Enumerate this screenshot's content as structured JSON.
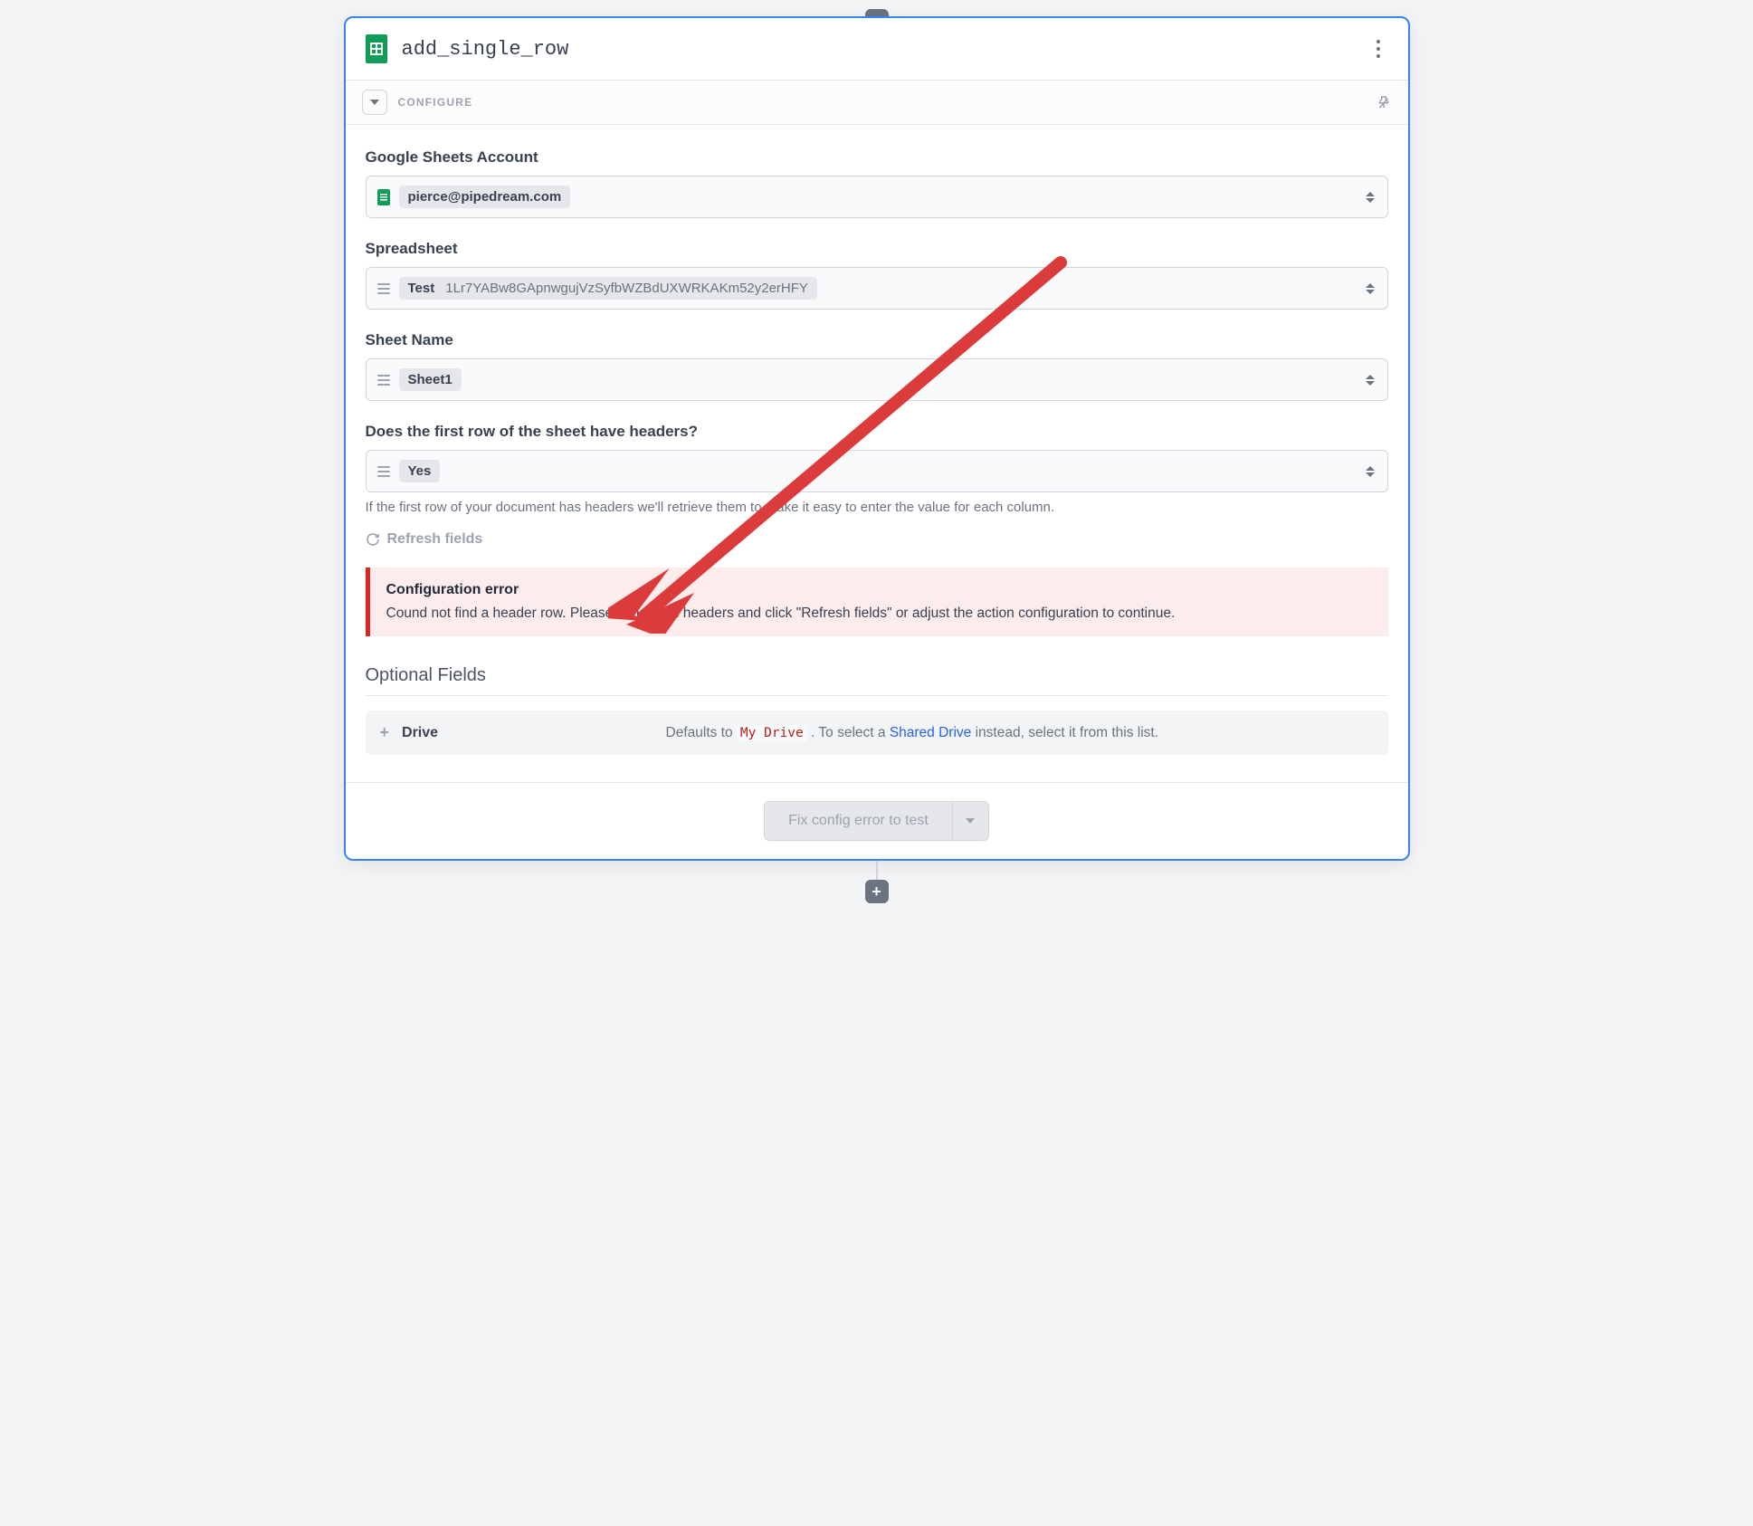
{
  "header": {
    "title": "add_single_row"
  },
  "configure_label": "CONFIGURE",
  "fields": {
    "account": {
      "label": "Google Sheets Account",
      "value": "pierce@pipedream.com"
    },
    "spreadsheet": {
      "label": "Spreadsheet",
      "name": "Test",
      "id": "1Lr7YABw8GApnwgujVzSyfbWZBdUXWRKAKm52y2erHFY"
    },
    "sheet": {
      "label": "Sheet Name",
      "value": "Sheet1"
    },
    "headers": {
      "label": "Does the first row of the sheet have headers?",
      "value": "Yes",
      "helper": "If the first row of your document has headers we'll retrieve them to make it easy to enter the value for each column."
    }
  },
  "refresh_label": "Refresh fields",
  "error": {
    "title": "Configuration error",
    "message": "Cound not find a header row. Please either add headers and click \"Refresh fields\" or adjust the action configuration to continue."
  },
  "optional": {
    "section_title": "Optional Fields",
    "drive": {
      "name": "Drive",
      "desc_prefix": "Defaults to ",
      "desc_code": "My Drive",
      "desc_mid": ". To select a ",
      "desc_link": "Shared Drive",
      "desc_suffix": " instead, select it from this list."
    }
  },
  "footer": {
    "test_disabled_label": "Fix config error to test"
  }
}
